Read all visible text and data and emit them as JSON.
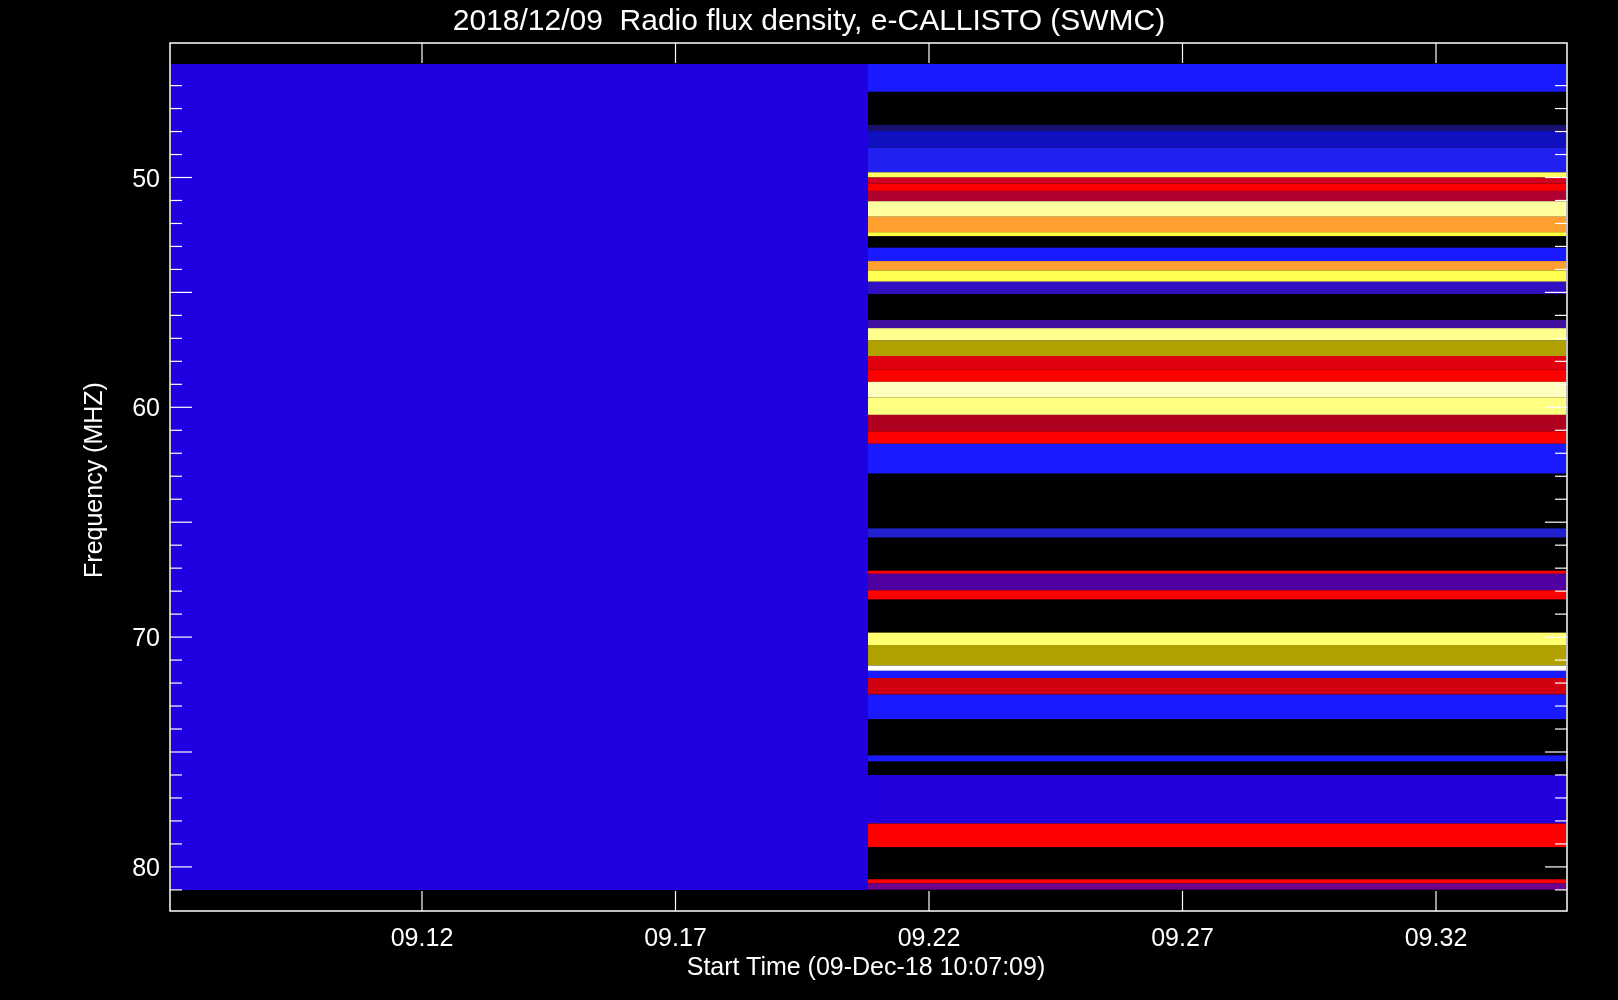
{
  "plot": {
    "title": "2018/12/09  Radio flux density, e-CALLISTO (SWMC)",
    "ylabel": "Frequency (MHZ)",
    "xlabel": "Start Time (09-Dec-18 10:07:09)",
    "xticks": [
      "09.12",
      "09.17",
      "09.22",
      "09.27",
      "09.32"
    ],
    "yticks": [
      "50",
      "60",
      "70",
      "80"
    ]
  }
}
